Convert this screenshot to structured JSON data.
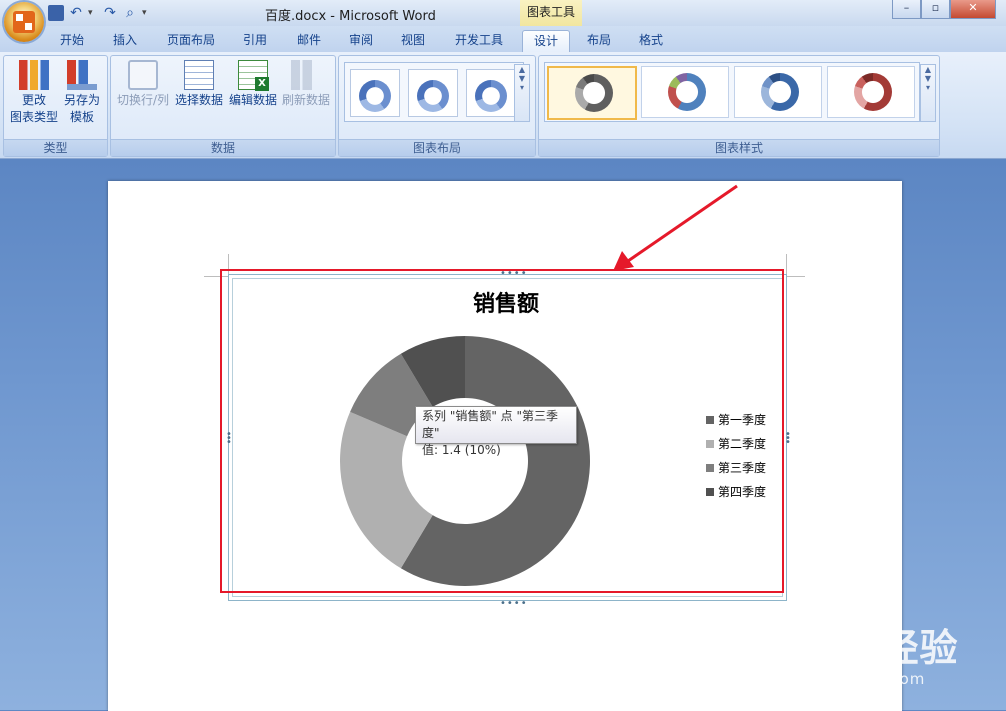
{
  "window": {
    "title": "百度.docx - Microsoft Word",
    "context_tab_title": "图表工具",
    "buttons": {
      "minimize": "–",
      "maximize": "▫",
      "close": "✕"
    }
  },
  "quick_access": {
    "icons": [
      "save-icon",
      "undo-icon",
      "redo-icon",
      "print-preview-icon"
    ]
  },
  "tabs": [
    {
      "label": "开始"
    },
    {
      "label": "插入"
    },
    {
      "label": "页面布局"
    },
    {
      "label": "引用"
    },
    {
      "label": "邮件"
    },
    {
      "label": "审阅"
    },
    {
      "label": "视图"
    },
    {
      "label": "开发工具"
    },
    {
      "label": "设计",
      "active": true
    },
    {
      "label": "布局"
    },
    {
      "label": "格式"
    }
  ],
  "ribbon": {
    "type_group": {
      "label": "类型",
      "change_type": "更改\n图表类型",
      "save_template": "另存为\n模板"
    },
    "data_group": {
      "label": "数据",
      "switch_row_col": "切换行/列",
      "select_data": "选择数据",
      "edit_data": "编辑数据",
      "refresh_data": "刷新数据"
    },
    "layout_group": {
      "label": "图表布局"
    },
    "style_group": {
      "label": "图表样式"
    }
  },
  "chart": {
    "tooltip_line1": "系列 \"销售额\" 点 \"第三季度\"",
    "tooltip_line2": "值: 1.4 (10%)"
  },
  "chart_data": {
    "type": "pie",
    "variant": "doughnut",
    "title": "销售额",
    "categories": [
      "第一季度",
      "第二季度",
      "第三季度",
      "第四季度"
    ],
    "series": [
      {
        "name": "销售额",
        "values": [
          8.2,
          3.2,
          1.4,
          1.2
        ]
      }
    ],
    "colors": [
      "#646464",
      "#b0b0b0",
      "#7e7e7e",
      "#505050"
    ],
    "legend": "right"
  },
  "watermark": {
    "logo": "Baidu经验",
    "url": "jingyan.baidu.com"
  },
  "colors": {
    "highlight": "#e5192a",
    "arrow": "#e5192a",
    "active_tab": "#ffffff"
  }
}
